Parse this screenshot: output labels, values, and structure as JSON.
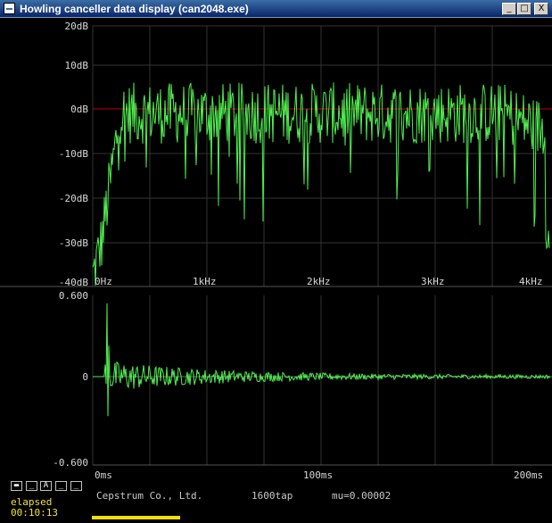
{
  "window": {
    "title": "Howling canceller data display (can2048.exe)",
    "buttons": {
      "minimize": "_",
      "maximize": "□",
      "close": "X"
    }
  },
  "spectrum": {
    "y_labels": [
      "20dB",
      "10dB",
      "0dB",
      "-10dB",
      "-20dB",
      "-30dB",
      "-40dB"
    ],
    "x_labels": [
      "0Hz",
      "1kHz",
      "2kHz",
      "3kHz",
      "4kHz"
    ],
    "reference_color": "#c00000",
    "trace_color": "#50f050"
  },
  "impulse": {
    "y_labels": [
      "0.600",
      "0",
      "-0.600"
    ],
    "x_labels": [
      "0ms",
      "100ms",
      "200ms"
    ]
  },
  "status": {
    "indicators": [
      "▬",
      "_",
      "A",
      "_",
      "_"
    ],
    "elapsed_label": "elapsed",
    "elapsed_value": "00:10:13",
    "company": "Cepstrum Co., Ltd.",
    "taps": "1600tap",
    "mu": "mu=0.00002"
  }
}
